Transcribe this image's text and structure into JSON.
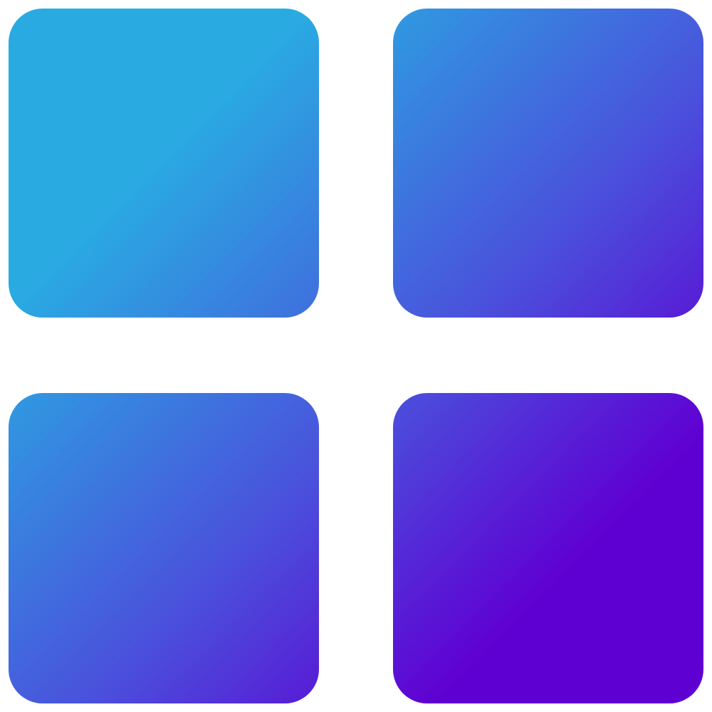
{
  "icon": {
    "name": "app-grid-icon",
    "tiles": 4
  },
  "colors": {
    "gradient_start": "#29abe2",
    "gradient_mid": "#4a52dc",
    "gradient_end": "#5f00d2",
    "background": "#ffffff"
  }
}
